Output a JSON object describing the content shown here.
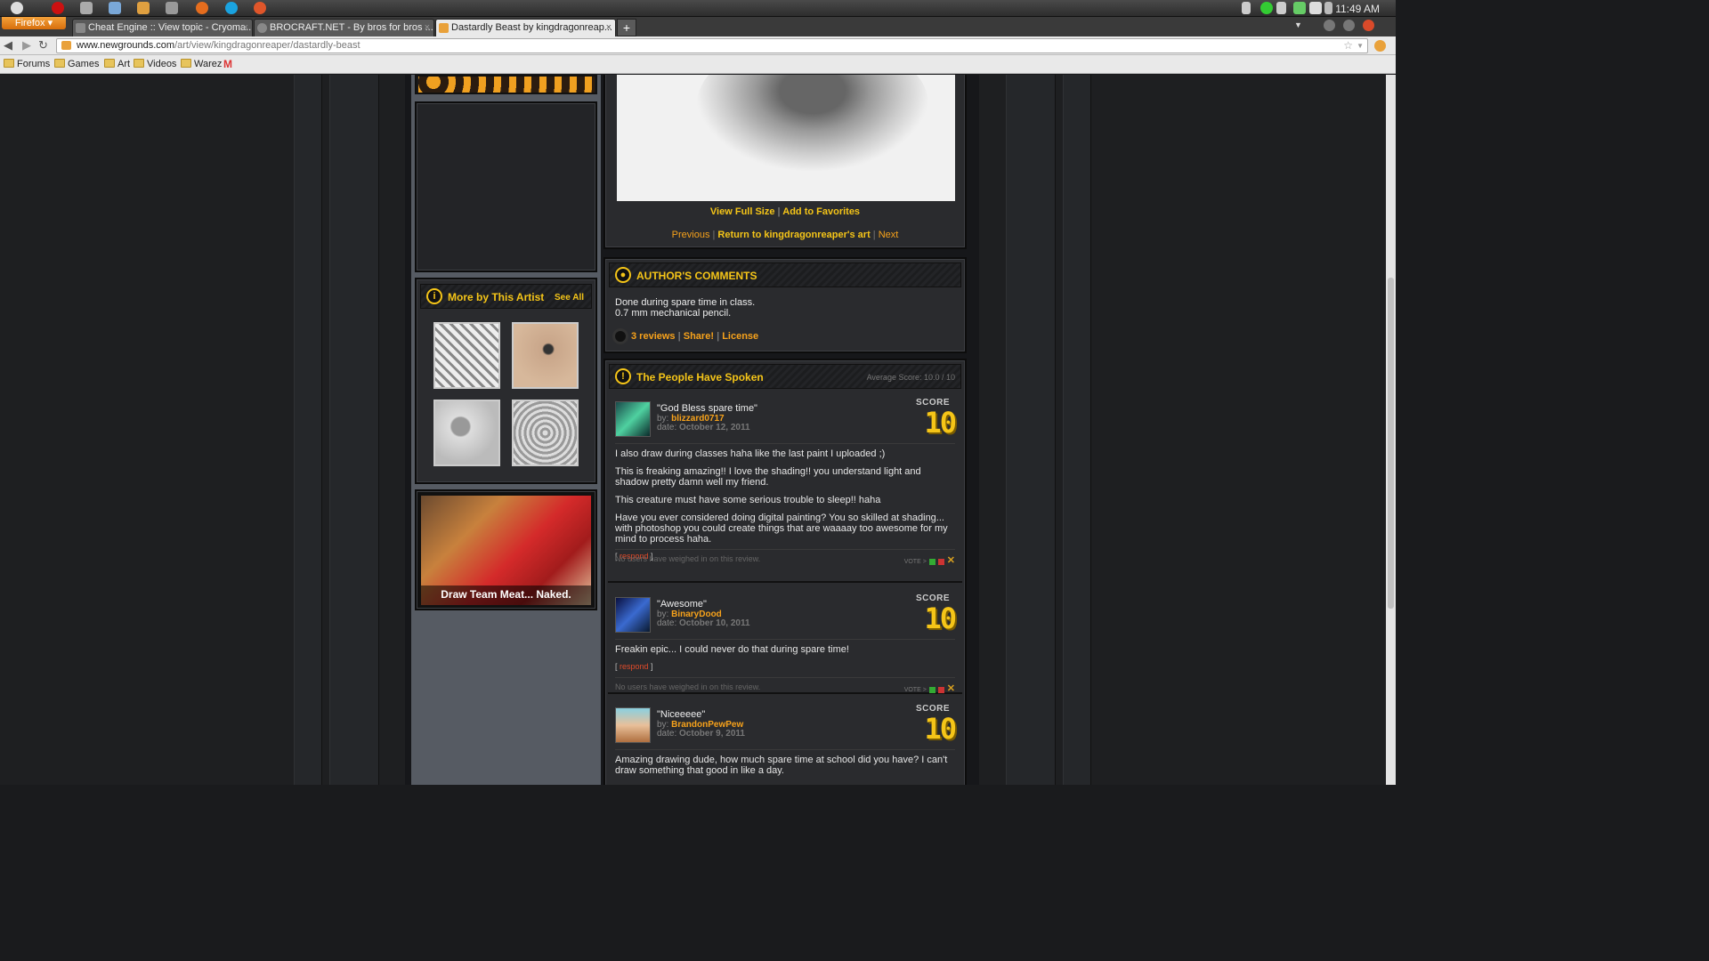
{
  "os": {
    "clock": "11:49 AM"
  },
  "browser": {
    "menu_button": "Firefox",
    "tabs": [
      {
        "title": "Cheat Engine :: View topic - Cryoma..."
      },
      {
        "title": "BROCRAFT.NET - By bros for bros ..."
      },
      {
        "title": "Dastardly Beast by kingdragonreap..."
      }
    ],
    "new_tab": "+",
    "url_domain": "www.newgrounds.com",
    "url_path": "/art/view/kingdragonreaper/dastardly-beast",
    "bookmarks": [
      "Forums",
      "Games",
      "Art",
      "Videos",
      "Warez"
    ]
  },
  "art": {
    "view_full_size": "View Full Size",
    "add_to_favorites": "Add to Favorites",
    "previous": "Previous",
    "return": "Return to kingdragonreaper's art",
    "next": "Next"
  },
  "more_by_artist": {
    "title": "More by This Artist",
    "see_all": "See All"
  },
  "ad": {
    "caption": "Draw Team Meat... Naked."
  },
  "author_comments": {
    "title": "AUTHOR'S COMMENTS",
    "line1": "Done during spare time in class.",
    "line2": "0.7 mm mechanical pencil.",
    "reviews_link": "3 reviews",
    "share_link": "Share!",
    "license_link": "License"
  },
  "people_spoken": {
    "title": "The People Have Spoken",
    "average": "Average Score: 10.0 / 10"
  },
  "reviews": [
    {
      "title": "\"God Bless spare time\"",
      "by_label": "by:",
      "author": "blizzard0717",
      "date_label": "date:",
      "date": "October 12, 2011",
      "score_label": "SCORE",
      "score": "10",
      "body": [
        "I also draw during classes haha like the last paint I uploaded ;)",
        "This is freaking amazing!! I love the shading!! you understand light and shadow pretty damn well my friend.",
        "This creature must have some serious trouble to sleep!! haha",
        "Have you ever considered doing digital painting? You so skilled at shading... with photoshop you could create things that are waaaay too awesome for my mind to process haha."
      ],
      "respond": "respond",
      "weigh": "No users have weighed in on this review.",
      "vote": "VOTE >"
    },
    {
      "title": "\"Awesome\"",
      "by_label": "by:",
      "author": "BinaryDood",
      "date_label": "date:",
      "date": "October 10, 2011",
      "score_label": "SCORE",
      "score": "10",
      "body": [
        "Freakin epic... I could never do that during spare time!"
      ],
      "respond": "respond",
      "weigh": "No users have weighed in on this review.",
      "vote": "VOTE >"
    },
    {
      "title": "\"Niceeeee\"",
      "by_label": "by:",
      "author": "BrandonPewPew",
      "date_label": "date:",
      "date": "October 9, 2011",
      "score_label": "SCORE",
      "score": "10",
      "body": [
        "Amazing drawing dude, how much spare time at school did you have? I can't draw something that good in like a day."
      ]
    }
  ],
  "colors": {
    "accent": "#f5c518",
    "link": "#f7a21b",
    "bg": "#1e1f21"
  }
}
